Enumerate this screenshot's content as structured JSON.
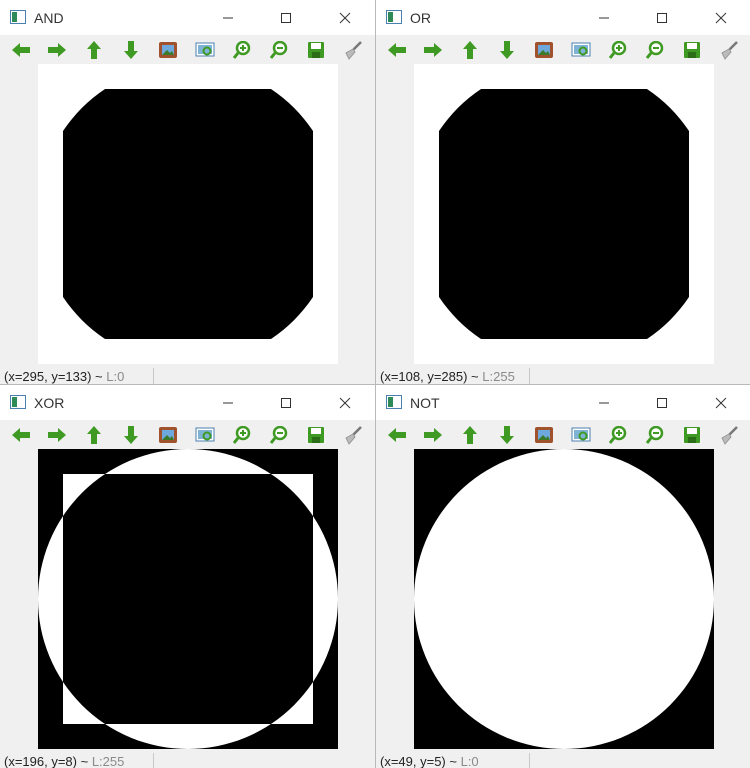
{
  "windows": [
    {
      "id": "and",
      "title": "AND",
      "status": {
        "coords": "(x=295, y=133) ~",
        "value": "L:0"
      }
    },
    {
      "id": "or",
      "title": "OR",
      "status": {
        "coords": "(x=108, y=285) ~",
        "value": "L:255"
      }
    },
    {
      "id": "xor",
      "title": "XOR",
      "status": {
        "coords": "(x=196, y=8) ~",
        "value": "L:255"
      }
    },
    {
      "id": "not",
      "title": "NOT",
      "status": {
        "coords": "(x=49, y=5) ~",
        "value": "L:0"
      }
    }
  ],
  "toolbar_icons": [
    "arrow-left-icon",
    "arrow-right-icon",
    "arrow-up-icon",
    "arrow-down-icon",
    "image-icon",
    "zoom-fit-icon",
    "zoom-in-icon",
    "zoom-out-icon",
    "save-icon",
    "brush-icon"
  ],
  "colors": {
    "toolbar_green": "#3f9a23",
    "titlebar": "#ffffff",
    "window_bg": "#f0f0f0"
  }
}
